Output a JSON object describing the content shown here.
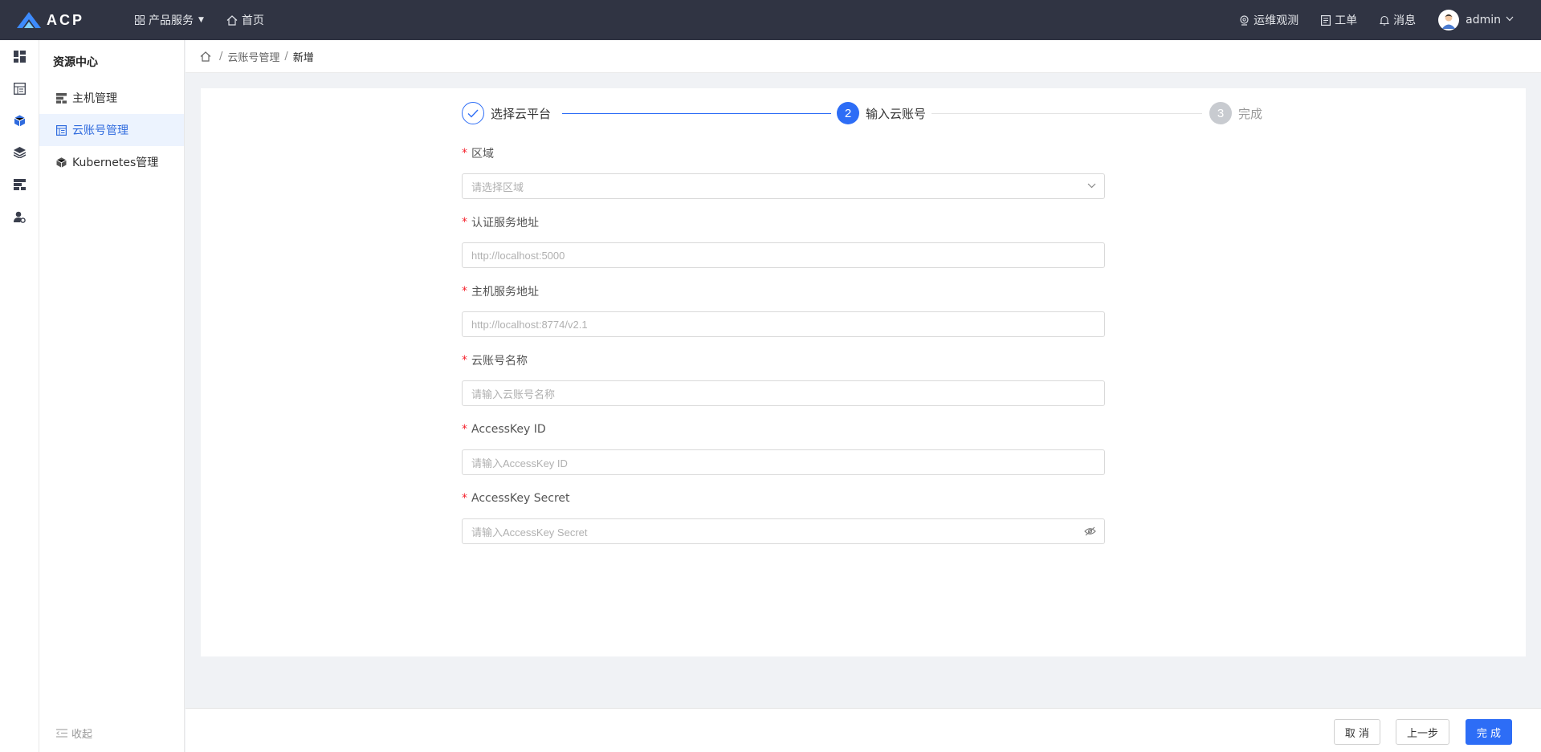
{
  "app": {
    "logo_text": "ACP"
  },
  "topbar": {
    "products_label": "产品服务",
    "home_label": "首页",
    "ops_label": "运维观测",
    "ticket_label": "工单",
    "message_label": "消息",
    "user_name": "admin"
  },
  "sidebar": {
    "title": "资源中心",
    "items": [
      {
        "label": "主机管理",
        "icon": "server-icon"
      },
      {
        "label": "云账号管理",
        "icon": "account-list-icon",
        "active": true
      },
      {
        "label": "Kubernetes管理",
        "icon": "cube-icon"
      }
    ],
    "collapse_label": "收起"
  },
  "rail": {
    "icons": [
      "dashboard-icon",
      "resource-icon",
      "cube-icon",
      "layers-icon",
      "storage-icon",
      "user-settings-icon"
    ]
  },
  "breadcrumb": {
    "parent": "云账号管理",
    "current": "新增"
  },
  "steps": [
    {
      "label": "选择云平台",
      "status": "finished"
    },
    {
      "number": "2",
      "label": "输入云账号",
      "status": "active"
    },
    {
      "number": "3",
      "label": "完成",
      "status": "waiting"
    }
  ],
  "form": {
    "region": {
      "label": "区域",
      "placeholder": "请选择区域"
    },
    "auth_url": {
      "label": "认证服务地址",
      "placeholder": "http://localhost:5000"
    },
    "compute_url": {
      "label": "主机服务地址",
      "placeholder": "http://localhost:8774/v2.1"
    },
    "account_name": {
      "label": "云账号名称",
      "placeholder": "请输入云账号名称"
    },
    "access_key_id": {
      "label": "AccessKey ID",
      "placeholder": "请输入AccessKey ID"
    },
    "access_key_secret": {
      "label": "AccessKey Secret",
      "placeholder": "请输入AccessKey Secret"
    }
  },
  "footer": {
    "cancel_label": "取 消",
    "prev_label": "上一步",
    "finish_label": "完 成"
  },
  "colors": {
    "topbar_bg": "#303443",
    "primary": "#2d6df6",
    "required": "#f5222d"
  }
}
